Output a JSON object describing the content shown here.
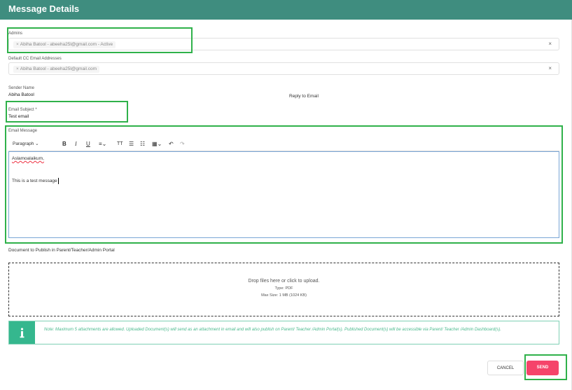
{
  "header": {
    "title": "Message Details"
  },
  "admins": {
    "label": "Admins",
    "chips": [
      "Abiha Batool - abeeha25l@gmail.com - Active"
    ],
    "clear": "×"
  },
  "cc": {
    "label": "Default CC Email Addresses",
    "chips": [
      "Abiha Batool - abeeha25l@gmail.com"
    ],
    "clear": "×"
  },
  "sender": {
    "label": "Sender Name",
    "value": "Abiha Batool"
  },
  "reply": {
    "label": "Reply to Email"
  },
  "subject": {
    "label": "Email Subject *",
    "value": "Test email"
  },
  "message": {
    "label": "Email Message",
    "toolbar": {
      "paragraph": "Paragraph",
      "bold": "B",
      "italic": "I",
      "underline": "U",
      "text_size": "TT"
    },
    "lines": [
      "Aslamoalaikum,",
      "This is a test message"
    ]
  },
  "document": {
    "label": "Document to Publish in Parent/Teacher/Admin Portal",
    "drop": "Drop files here or click to upload.",
    "type": "Type: PDF",
    "max_size": "Max Size: 1 MB (1024 KB)"
  },
  "note": {
    "text": "Note: Maximum 5 attachments are allowed. Uploaded Document(s) will send as an attachment in email and will also publish on Parent/ Teacher /Admin Portal(s). Published Document(s) will be accessible via Parent/ Teacher /Admin Dashboard(s)."
  },
  "actions": {
    "cancel": "CANCEL",
    "send": "SEND"
  },
  "colors": {
    "header": "#3f8d7f",
    "highlight": "#2fb14a",
    "send": "#f5446a",
    "note": "#35b78e"
  }
}
